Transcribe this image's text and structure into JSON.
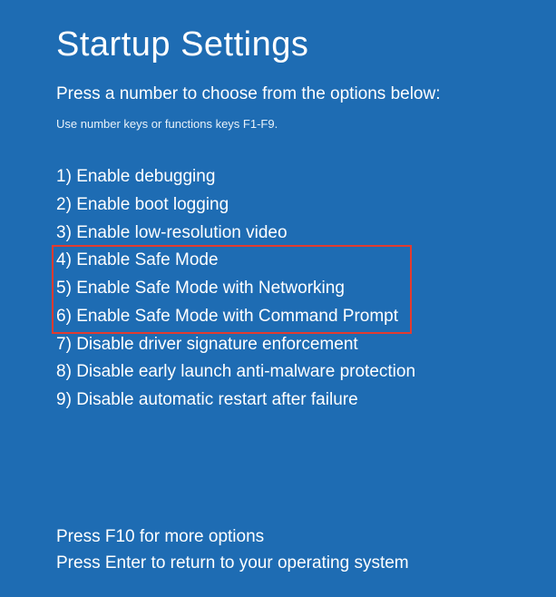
{
  "title": "Startup Settings",
  "instruction": "Press a number to choose from the options below:",
  "hint": "Use number keys or functions keys F1-F9.",
  "options": [
    {
      "n": "1)",
      "label": "Enable debugging"
    },
    {
      "n": "2)",
      "label": "Enable boot logging"
    },
    {
      "n": "3)",
      "label": "Enable low-resolution video"
    },
    {
      "n": "4)",
      "label": "Enable Safe Mode"
    },
    {
      "n": "5)",
      "label": "Enable Safe Mode with Networking"
    },
    {
      "n": "6)",
      "label": "Enable Safe Mode with Command Prompt"
    },
    {
      "n": "7)",
      "label": "Disable driver signature enforcement"
    },
    {
      "n": "8)",
      "label": "Disable early launch anti-malware protection"
    },
    {
      "n": "9)",
      "label": "Disable automatic restart after failure"
    }
  ],
  "footer": {
    "more": "Press F10 for more options",
    "return": "Press Enter to return to your operating system"
  }
}
